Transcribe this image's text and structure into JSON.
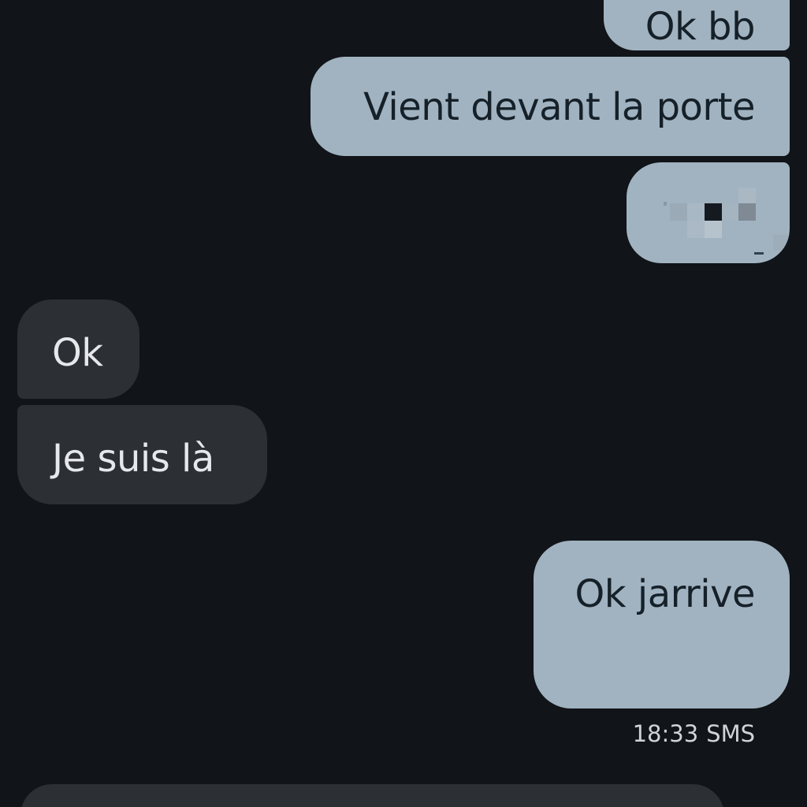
{
  "conversation": {
    "messages": [
      {
        "direction": "sent",
        "text": "Ok bb"
      },
      {
        "direction": "sent",
        "text": "Vient devant la porte"
      },
      {
        "direction": "sent",
        "text": "",
        "content": "pixelated-emoji"
      },
      {
        "direction": "received",
        "text": "Ok"
      },
      {
        "direction": "received",
        "text": "Je suis là"
      },
      {
        "direction": "sent",
        "text": "Ok jarrive"
      }
    ],
    "last_meta": {
      "time": "18:33",
      "type": "SMS"
    }
  },
  "colors": {
    "background": "#111418",
    "sent_bubble": "#a1b3c1",
    "sent_text": "#152029",
    "received_bubble": "#2c2f33",
    "received_text": "#e6e8eb"
  }
}
